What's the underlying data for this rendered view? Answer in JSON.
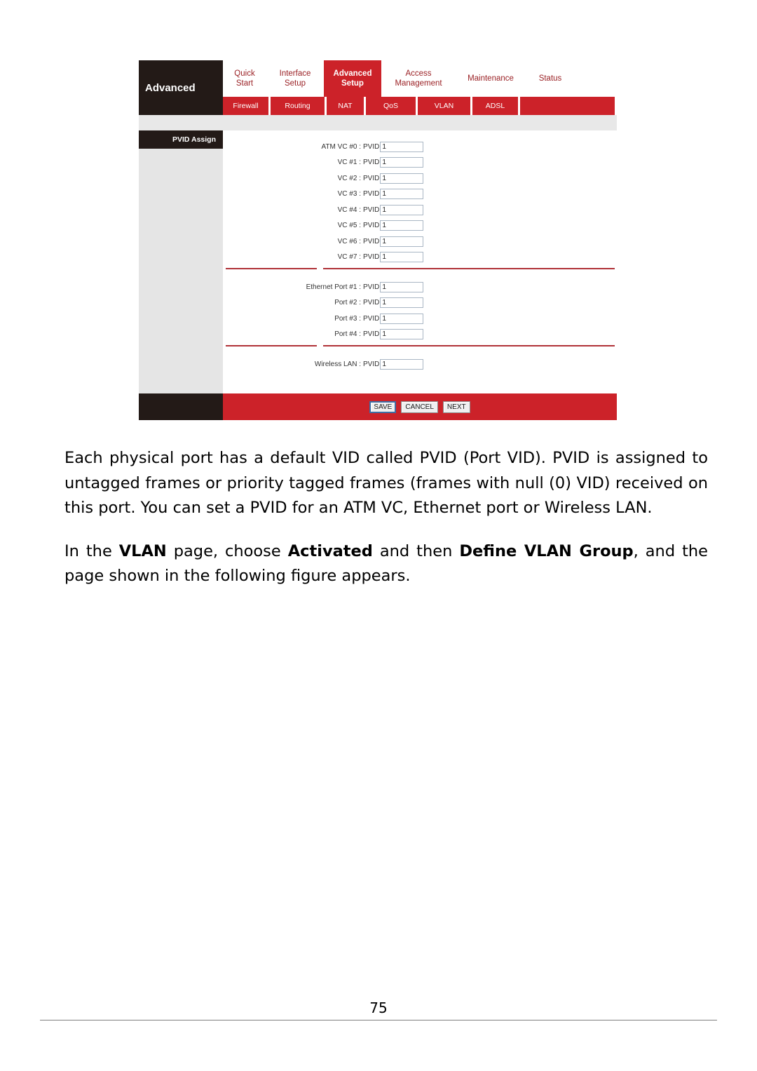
{
  "figure": {
    "brand": "Advanced",
    "primary_tabs": [
      {
        "label_line1": "Quick",
        "label_line2": "Start",
        "active": false
      },
      {
        "label_line1": "Interface",
        "label_line2": "Setup",
        "active": false
      },
      {
        "label_line1": "Advanced",
        "label_line2": "Setup",
        "active": true
      },
      {
        "label_line1": "Access",
        "label_line2": "Management",
        "active": false
      },
      {
        "label_line1": "Maintenance",
        "label_line2": "",
        "active": false
      },
      {
        "label_line1": "Status",
        "label_line2": "",
        "active": false
      }
    ],
    "sub_tabs": [
      {
        "label": "Firewall"
      },
      {
        "label": "Routing"
      },
      {
        "label": "NAT"
      },
      {
        "label": "QoS"
      },
      {
        "label": "VLAN"
      },
      {
        "label": "ADSL"
      }
    ],
    "sidebar": {
      "title": "PVID Assign"
    },
    "form": {
      "pvid_label": "PVID",
      "vc_rows": [
        {
          "label": "ATM VC #0 :",
          "value": "1"
        },
        {
          "label": "VC #1 :",
          "value": "1"
        },
        {
          "label": "VC #2 :",
          "value": "1"
        },
        {
          "label": "VC #3 :",
          "value": "1"
        },
        {
          "label": "VC #4 :",
          "value": "1"
        },
        {
          "label": "VC #5 :",
          "value": "1"
        },
        {
          "label": "VC #6 :",
          "value": "1"
        },
        {
          "label": "VC #7 :",
          "value": "1"
        }
      ],
      "eth_rows": [
        {
          "label": "Ethernet Port #1 :",
          "value": "1"
        },
        {
          "label": "Port #2 :",
          "value": "1"
        },
        {
          "label": "Port #3 :",
          "value": "1"
        },
        {
          "label": "Port #4 :",
          "value": "1"
        }
      ],
      "wlan_rows": [
        {
          "label": "Wireless LAN :",
          "value": "1"
        }
      ]
    },
    "buttons": {
      "save": "SAVE",
      "cancel": "CANCEL",
      "next": "NEXT"
    },
    "colors": {
      "brand_red": "#cc2229",
      "divider_red": "#b03137",
      "dark_brown": "#231a17",
      "sidebar_gray": "#e5e5e5",
      "strip_gray": "#e8e8e8"
    }
  },
  "document": {
    "paragraph1": "Each physical port has a default VID called PVID (Port VID). PVID is assigned to untagged frames or priority tagged frames (frames with null (0) VID) received on this port. You can set a PVID for an ATM VC, Ethernet port or Wireless LAN.",
    "paragraph2": {
      "part1": "In the ",
      "bold1": "VLAN",
      "part2": " page, choose ",
      "bold2": "Activated",
      "part3": " and then ",
      "bold3": "Define VLAN Group",
      "part4": ", and the page shown in the following figure appears."
    },
    "page_number": "75"
  }
}
